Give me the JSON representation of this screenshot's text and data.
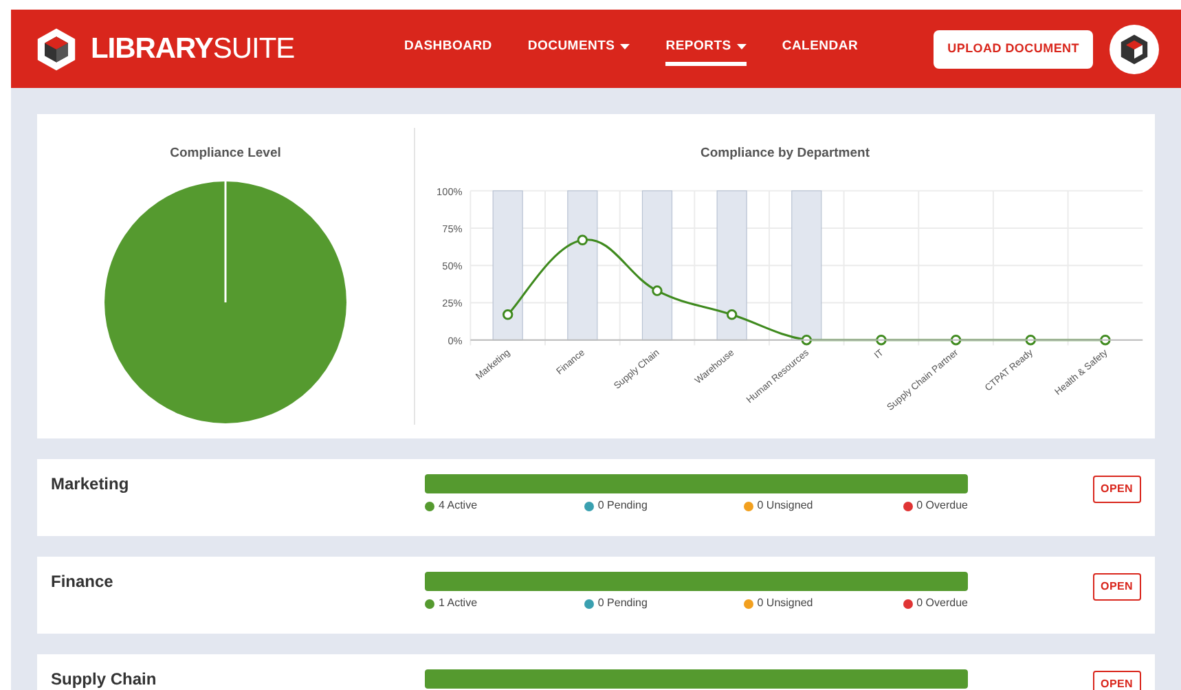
{
  "header": {
    "logo_bold": "LIBRARY",
    "logo_light": "SUITE",
    "nav": [
      {
        "label": "DASHBOARD",
        "dropdown": false,
        "selected": false
      },
      {
        "label": "DOCUMENTS",
        "dropdown": true,
        "selected": false
      },
      {
        "label": "REPORTS",
        "dropdown": true,
        "selected": true
      },
      {
        "label": "CALENDAR",
        "dropdown": false,
        "selected": false
      }
    ],
    "upload_button": "UPLOAD DOCUMENT"
  },
  "compliance_level": {
    "title": "Compliance Level"
  },
  "compliance_by_department": {
    "title": "Compliance by Department",
    "chart_data": {
      "type": "bar",
      "categories": [
        "Marketing",
        "Finance",
        "Supply Chain",
        "Warehouse",
        "Human Resources",
        "IT",
        "Supply Chain Partner",
        "CTPAT Ready",
        "Health &  Safety"
      ],
      "grid": true,
      "ylim": [
        0,
        100
      ],
      "yticks": [
        {
          "value": 0,
          "label": "0%"
        },
        {
          "value": 25,
          "label": "25%"
        },
        {
          "value": 50,
          "label": "50%"
        },
        {
          "value": 75,
          "label": "75%"
        },
        {
          "value": 100,
          "label": "100%"
        }
      ],
      "series": [
        {
          "color": "#e1e6ef",
          "values": [
            100,
            100,
            100,
            100,
            100,
            null,
            null,
            null,
            null
          ]
        },
        {
          "type": "line",
          "marker": "o",
          "color": "#3f8a1e",
          "values": [
            17,
            67,
            33,
            17,
            0,
            0,
            0,
            0,
            0
          ]
        }
      ]
    }
  },
  "departments": [
    {
      "name": "Marketing",
      "level": 1,
      "stats": [
        {
          "text": "4 Active",
          "color": "#559a2f"
        },
        {
          "text": "0 Pending",
          "color": "#3aa0b0"
        },
        {
          "text": "0 Unsigned",
          "color": "#f2a01f"
        },
        {
          "text": "0 Overdue",
          "color": "#e03434"
        }
      ],
      "button": "OPEN"
    },
    {
      "name": "Finance",
      "level": 1,
      "stats": [
        {
          "text": "1 Active",
          "color": "#559a2f"
        },
        {
          "text": "0 Pending",
          "color": "#3aa0b0"
        },
        {
          "text": "0 Unsigned",
          "color": "#f2a01f"
        },
        {
          "text": "0 Overdue",
          "color": "#e03434"
        }
      ],
      "button": "OPEN"
    },
    {
      "name": "Supply Chain",
      "level": 1,
      "button": "OPEN"
    }
  ]
}
